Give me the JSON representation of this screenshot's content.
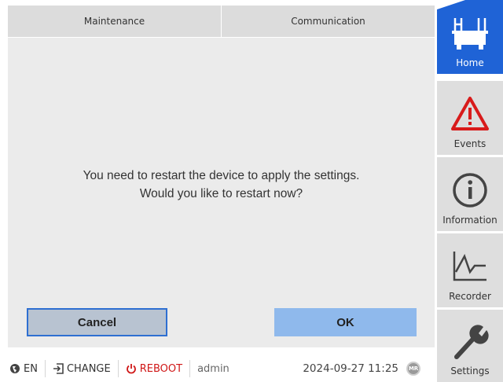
{
  "tabs": [
    {
      "label": "Maintenance"
    },
    {
      "label": "Communication"
    }
  ],
  "dialog": {
    "message_line1": "You need to restart the device to apply the settings.",
    "message_line2": "Would you like to restart now?",
    "cancel_label": "Cancel",
    "ok_label": "OK"
  },
  "status_bar": {
    "language": "EN",
    "change_label": "CHANGE",
    "reboot_label": "REBOOT",
    "user": "admin",
    "datetime": "2024-09-27 11:25",
    "logo_text": "MR"
  },
  "nav": {
    "items": [
      {
        "label": "Home",
        "icon": "transformer-icon",
        "active": true
      },
      {
        "label": "Events",
        "icon": "warning-icon"
      },
      {
        "label": "Information",
        "icon": "info-icon"
      },
      {
        "label": "Recorder",
        "icon": "chart-icon"
      },
      {
        "label": "Settings",
        "icon": "wrench-icon"
      }
    ]
  },
  "colors": {
    "accent": "#1f63d6",
    "reboot": "#d01818",
    "warning": "#d81b1b",
    "ok_button": "#8fb9ec",
    "cancel_button": "#b8c3d1"
  }
}
